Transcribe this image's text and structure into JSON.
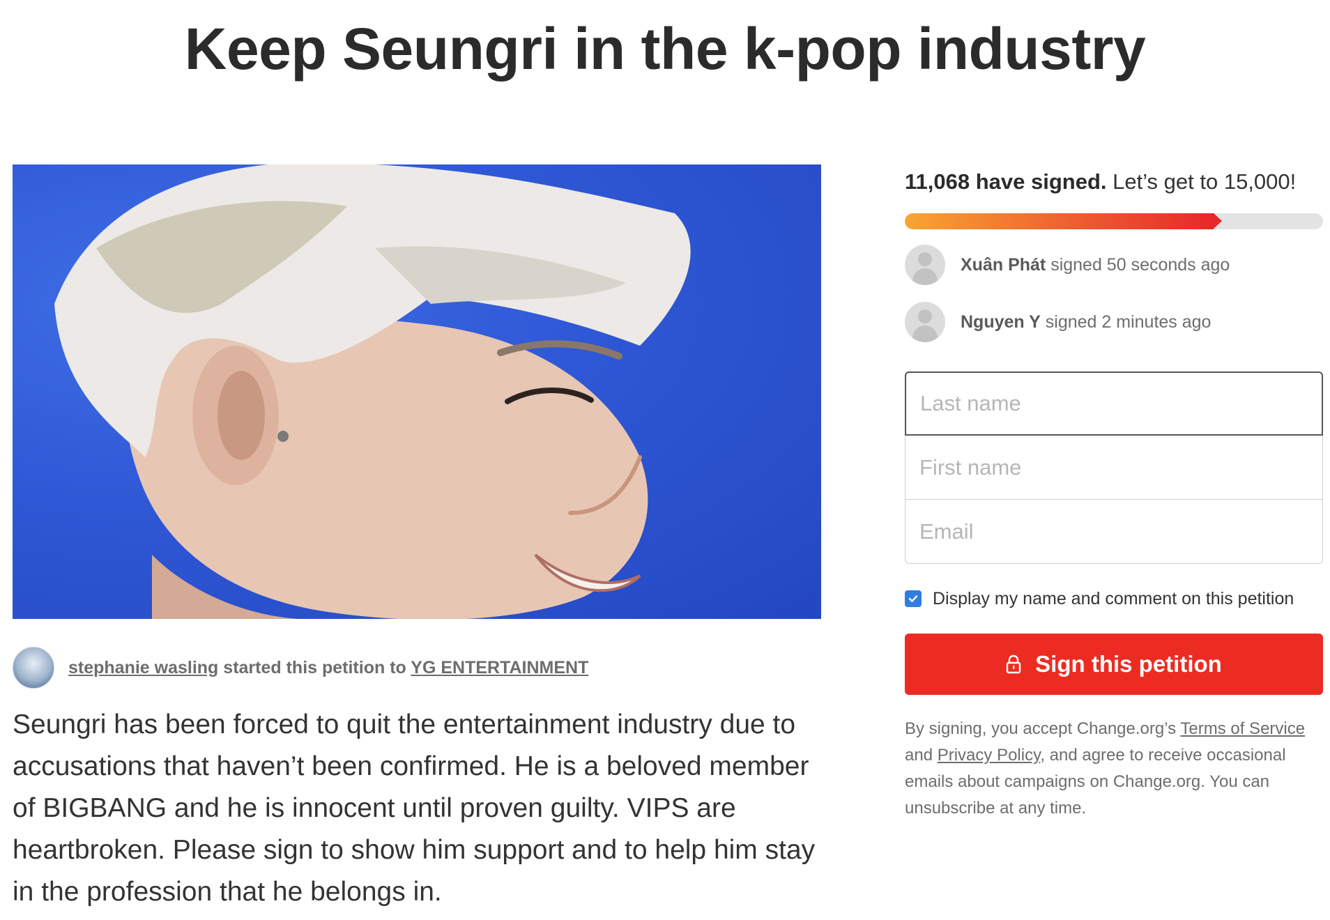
{
  "title": "Keep Seungri in the k-pop industry",
  "starter": {
    "name": "stephanie wasling",
    "middle": " started this petition to ",
    "recipient": "YG ENTERTAINMENT"
  },
  "description": "Seungri has been forced to quit the entertainment industry due to accusations that haven’t been confirmed. He is a beloved member of BIGBANG and he is innocent until proven guilty. VIPS are heartbroken. Please sign to show him support and to help him stay in the profession that he belongs in.",
  "goal": {
    "count_text": "11,068 have signed.",
    "target_text": " Let’s get to 15,000!",
    "progress_fraction": 0.7379
  },
  "recent_signers": [
    {
      "name": "Xuân Phát",
      "action": " signed 50 seconds ago"
    },
    {
      "name": "Nguyen Y",
      "action": " signed 2 minutes ago"
    }
  ],
  "form": {
    "last_name_placeholder": "Last name",
    "first_name_placeholder": "First name",
    "email_placeholder": "Email",
    "display_checkbox_label": "Display my name and comment on this petition",
    "display_checked": true,
    "sign_button_label": "Sign this petition"
  },
  "legal": {
    "prefix": "By signing, you accept Change.org’s ",
    "terms": "Terms of Service",
    "and": " and ",
    "privacy": "Privacy Policy",
    "suffix": ", and agree to receive occasional emails about campaigns on Change.org. You can unsubscribe at any time."
  },
  "colors": {
    "accent": "#ec2c22",
    "checkbox": "#2f7de1",
    "progress_start": "#f7a531",
    "progress_end": "#e6282a"
  }
}
